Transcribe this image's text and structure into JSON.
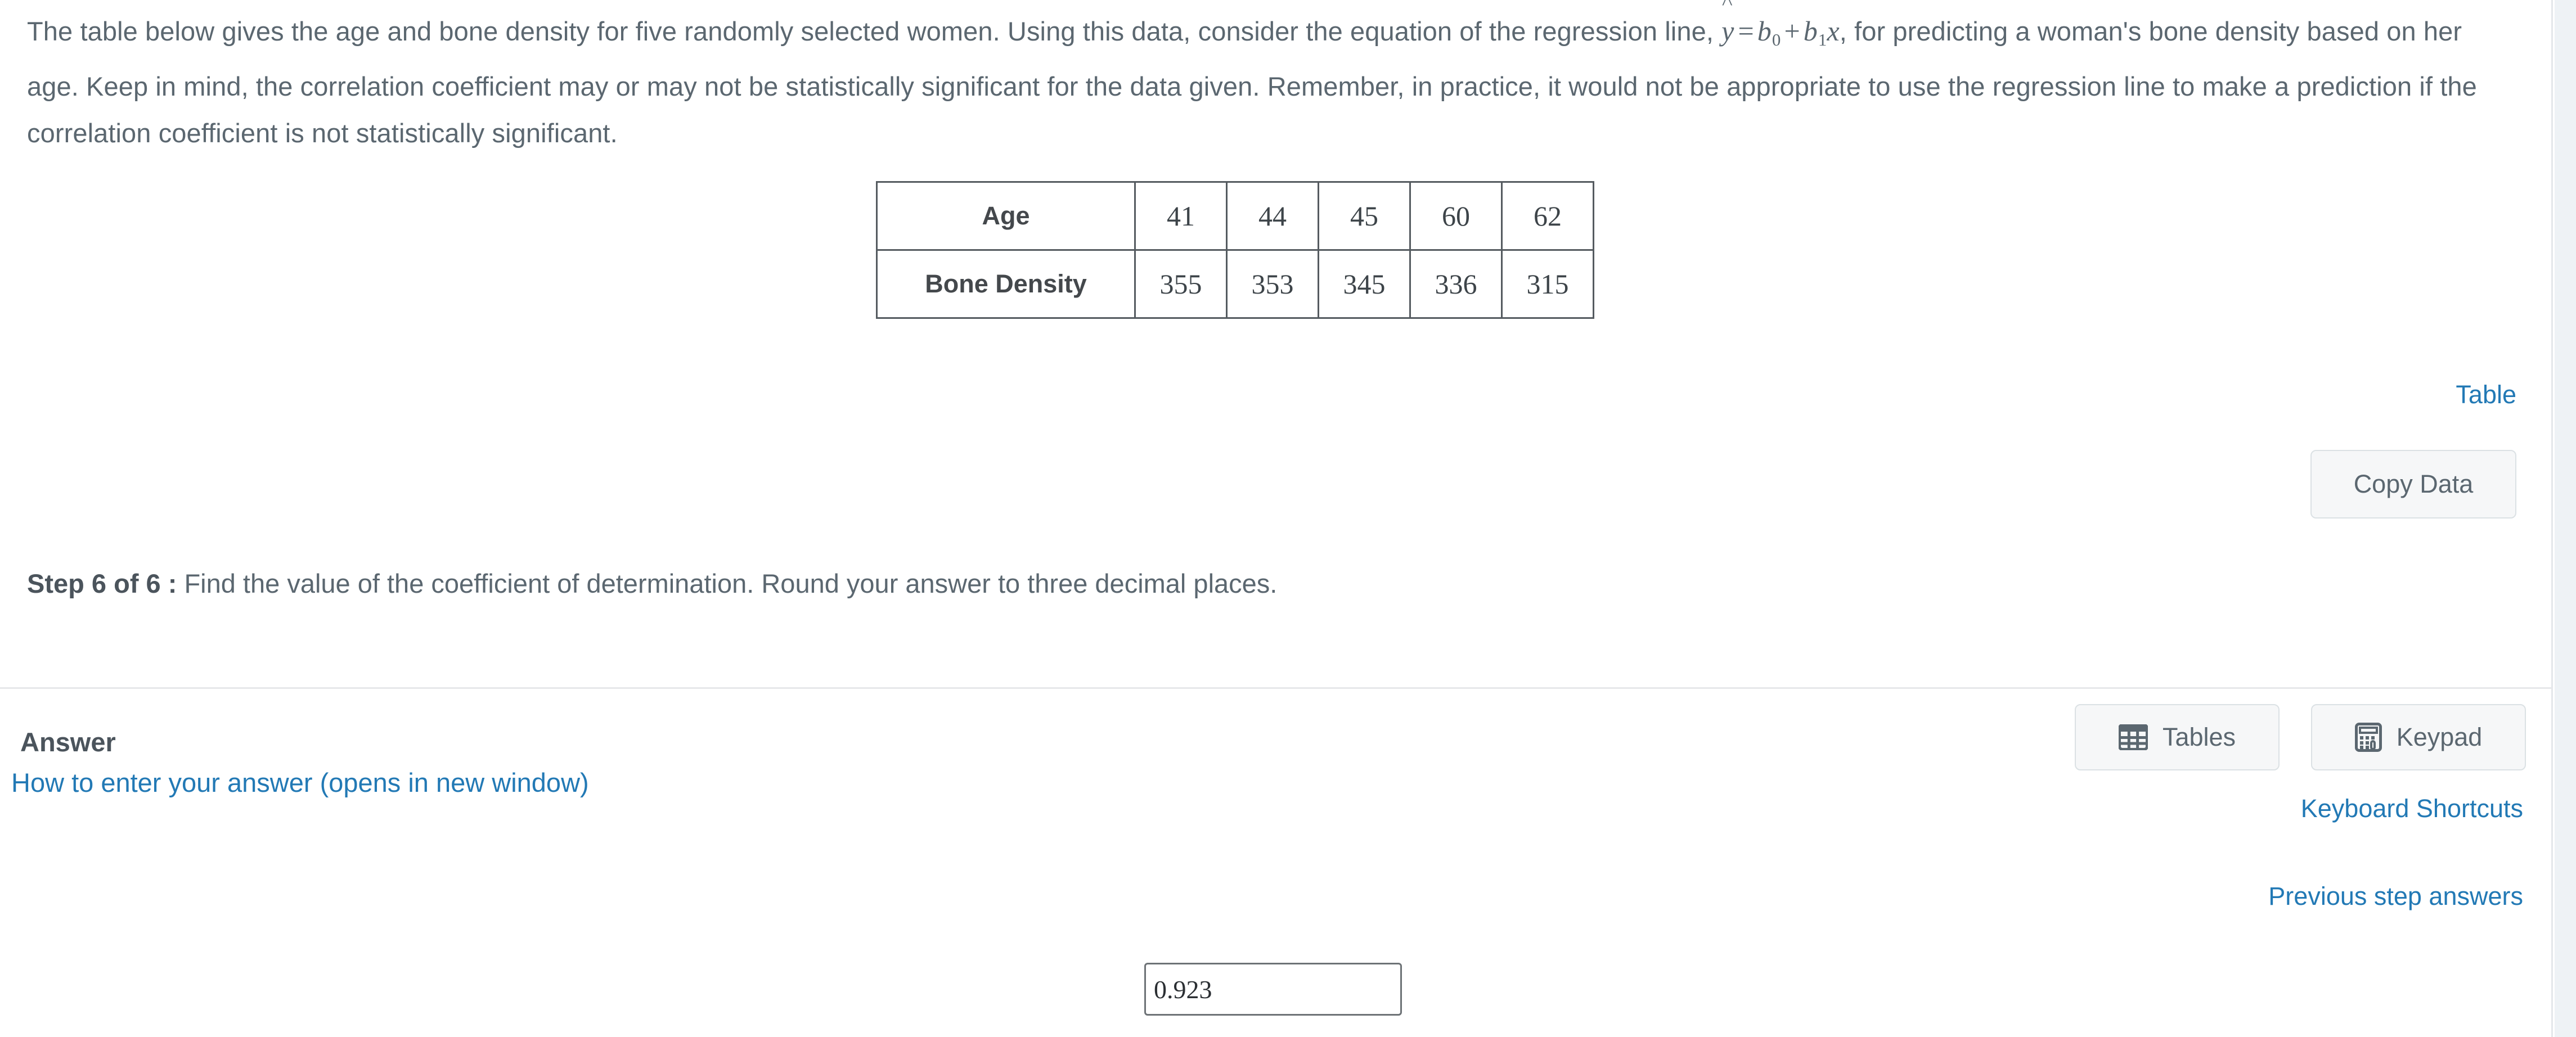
{
  "problem": {
    "text_part1": "The table below gives the age and bone density for five randomly selected women. Using this data, consider the equation of the regression line, ",
    "equation": "ŷ = b₀ + b₁x",
    "equation_parts": {
      "yhat": "y",
      "hat": "^",
      "equals": "=",
      "b": "b",
      "sub0": "0",
      "plus": "+",
      "sub1": "1",
      "x": "x"
    },
    "text_part2": ", for predicting a woman's bone density based on her age. Keep in mind, the correlation coefficient may or may not be statistically significant for the data given. Remember, in practice, it would not be appropriate to use the regression line to make a prediction if the correlation coefficient is not statistically significant."
  },
  "data_table": {
    "rows": [
      {
        "header": "Age",
        "values": [
          "41",
          "44",
          "45",
          "60",
          "62"
        ]
      },
      {
        "header": "Bone Density",
        "values": [
          "355",
          "353",
          "345",
          "336",
          "315"
        ]
      }
    ]
  },
  "links": {
    "table": "Table",
    "keyboard_shortcuts": "Keyboard Shortcuts",
    "previous_step_answers": "Previous step answers",
    "answer_help": "How to enter your answer (opens in new window)"
  },
  "buttons": {
    "copy_data": "Copy Data",
    "tables": "Tables",
    "keypad": "Keypad"
  },
  "step": {
    "label": "Step 6 of 6 :",
    "instruction": "Find the value of the coefficient of determination. Round your answer to three decimal places."
  },
  "answer": {
    "title": "Answer",
    "value": "0.923",
    "placeholder": ""
  },
  "colors": {
    "link_blue": "#2279b5",
    "body_text": "#5b6770",
    "table_border": "#555b60",
    "button_bg": "#f6f7f8",
    "gutter": "#eef2f5"
  }
}
